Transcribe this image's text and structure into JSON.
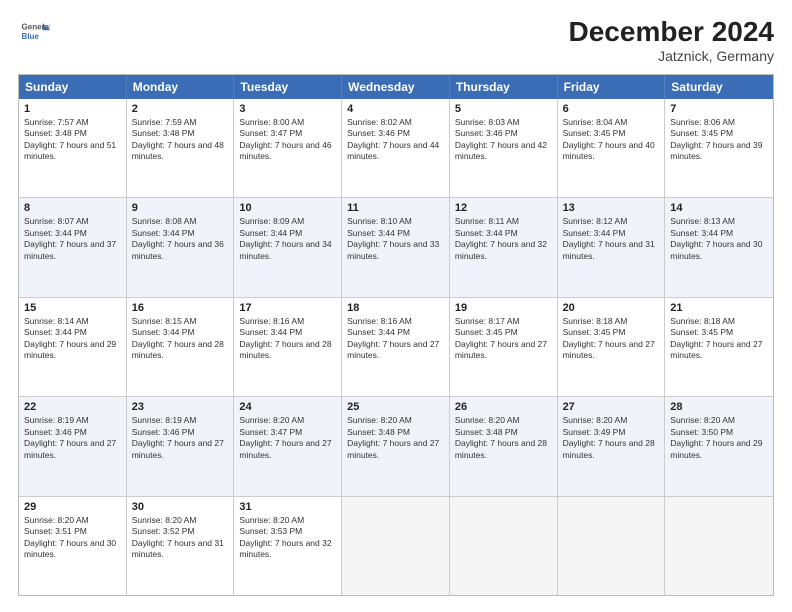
{
  "logo": {
    "line1": "General",
    "line2": "Blue"
  },
  "title": "December 2024",
  "subtitle": "Jatznick, Germany",
  "days": [
    "Sunday",
    "Monday",
    "Tuesday",
    "Wednesday",
    "Thursday",
    "Friday",
    "Saturday"
  ],
  "weeks": [
    {
      "alt": false,
      "cells": [
        {
          "day": 1,
          "rise": "7:57 AM",
          "set": "3:48 PM",
          "light": "7 hours and 51 minutes."
        },
        {
          "day": 2,
          "rise": "7:59 AM",
          "set": "3:48 PM",
          "light": "7 hours and 48 minutes."
        },
        {
          "day": 3,
          "rise": "8:00 AM",
          "set": "3:47 PM",
          "light": "7 hours and 46 minutes."
        },
        {
          "day": 4,
          "rise": "8:02 AM",
          "set": "3:46 PM",
          "light": "7 hours and 44 minutes."
        },
        {
          "day": 5,
          "rise": "8:03 AM",
          "set": "3:46 PM",
          "light": "7 hours and 42 minutes."
        },
        {
          "day": 6,
          "rise": "8:04 AM",
          "set": "3:45 PM",
          "light": "7 hours and 40 minutes."
        },
        {
          "day": 7,
          "rise": "8:06 AM",
          "set": "3:45 PM",
          "light": "7 hours and 39 minutes."
        }
      ]
    },
    {
      "alt": true,
      "cells": [
        {
          "day": 8,
          "rise": "8:07 AM",
          "set": "3:44 PM",
          "light": "7 hours and 37 minutes."
        },
        {
          "day": 9,
          "rise": "8:08 AM",
          "set": "3:44 PM",
          "light": "7 hours and 36 minutes."
        },
        {
          "day": 10,
          "rise": "8:09 AM",
          "set": "3:44 PM",
          "light": "7 hours and 34 minutes."
        },
        {
          "day": 11,
          "rise": "8:10 AM",
          "set": "3:44 PM",
          "light": "7 hours and 33 minutes."
        },
        {
          "day": 12,
          "rise": "8:11 AM",
          "set": "3:44 PM",
          "light": "7 hours and 32 minutes."
        },
        {
          "day": 13,
          "rise": "8:12 AM",
          "set": "3:44 PM",
          "light": "7 hours and 31 minutes."
        },
        {
          "day": 14,
          "rise": "8:13 AM",
          "set": "3:44 PM",
          "light": "7 hours and 30 minutes."
        }
      ]
    },
    {
      "alt": false,
      "cells": [
        {
          "day": 15,
          "rise": "8:14 AM",
          "set": "3:44 PM",
          "light": "7 hours and 29 minutes."
        },
        {
          "day": 16,
          "rise": "8:15 AM",
          "set": "3:44 PM",
          "light": "7 hours and 28 minutes."
        },
        {
          "day": 17,
          "rise": "8:16 AM",
          "set": "3:44 PM",
          "light": "7 hours and 28 minutes."
        },
        {
          "day": 18,
          "rise": "8:16 AM",
          "set": "3:44 PM",
          "light": "7 hours and 27 minutes."
        },
        {
          "day": 19,
          "rise": "8:17 AM",
          "set": "3:45 PM",
          "light": "7 hours and 27 minutes."
        },
        {
          "day": 20,
          "rise": "8:18 AM",
          "set": "3:45 PM",
          "light": "7 hours and 27 minutes."
        },
        {
          "day": 21,
          "rise": "8:18 AM",
          "set": "3:45 PM",
          "light": "7 hours and 27 minutes."
        }
      ]
    },
    {
      "alt": true,
      "cells": [
        {
          "day": 22,
          "rise": "8:19 AM",
          "set": "3:46 PM",
          "light": "7 hours and 27 minutes."
        },
        {
          "day": 23,
          "rise": "8:19 AM",
          "set": "3:46 PM",
          "light": "7 hours and 27 minutes."
        },
        {
          "day": 24,
          "rise": "8:20 AM",
          "set": "3:47 PM",
          "light": "7 hours and 27 minutes."
        },
        {
          "day": 25,
          "rise": "8:20 AM",
          "set": "3:48 PM",
          "light": "7 hours and 27 minutes."
        },
        {
          "day": 26,
          "rise": "8:20 AM",
          "set": "3:48 PM",
          "light": "7 hours and 28 minutes."
        },
        {
          "day": 27,
          "rise": "8:20 AM",
          "set": "3:49 PM",
          "light": "7 hours and 28 minutes."
        },
        {
          "day": 28,
          "rise": "8:20 AM",
          "set": "3:50 PM",
          "light": "7 hours and 29 minutes."
        }
      ]
    },
    {
      "alt": false,
      "cells": [
        {
          "day": 29,
          "rise": "8:20 AM",
          "set": "3:51 PM",
          "light": "7 hours and 30 minutes."
        },
        {
          "day": 30,
          "rise": "8:20 AM",
          "set": "3:52 PM",
          "light": "7 hours and 31 minutes."
        },
        {
          "day": 31,
          "rise": "8:20 AM",
          "set": "3:53 PM",
          "light": "7 hours and 32 minutes."
        },
        null,
        null,
        null,
        null
      ]
    }
  ]
}
